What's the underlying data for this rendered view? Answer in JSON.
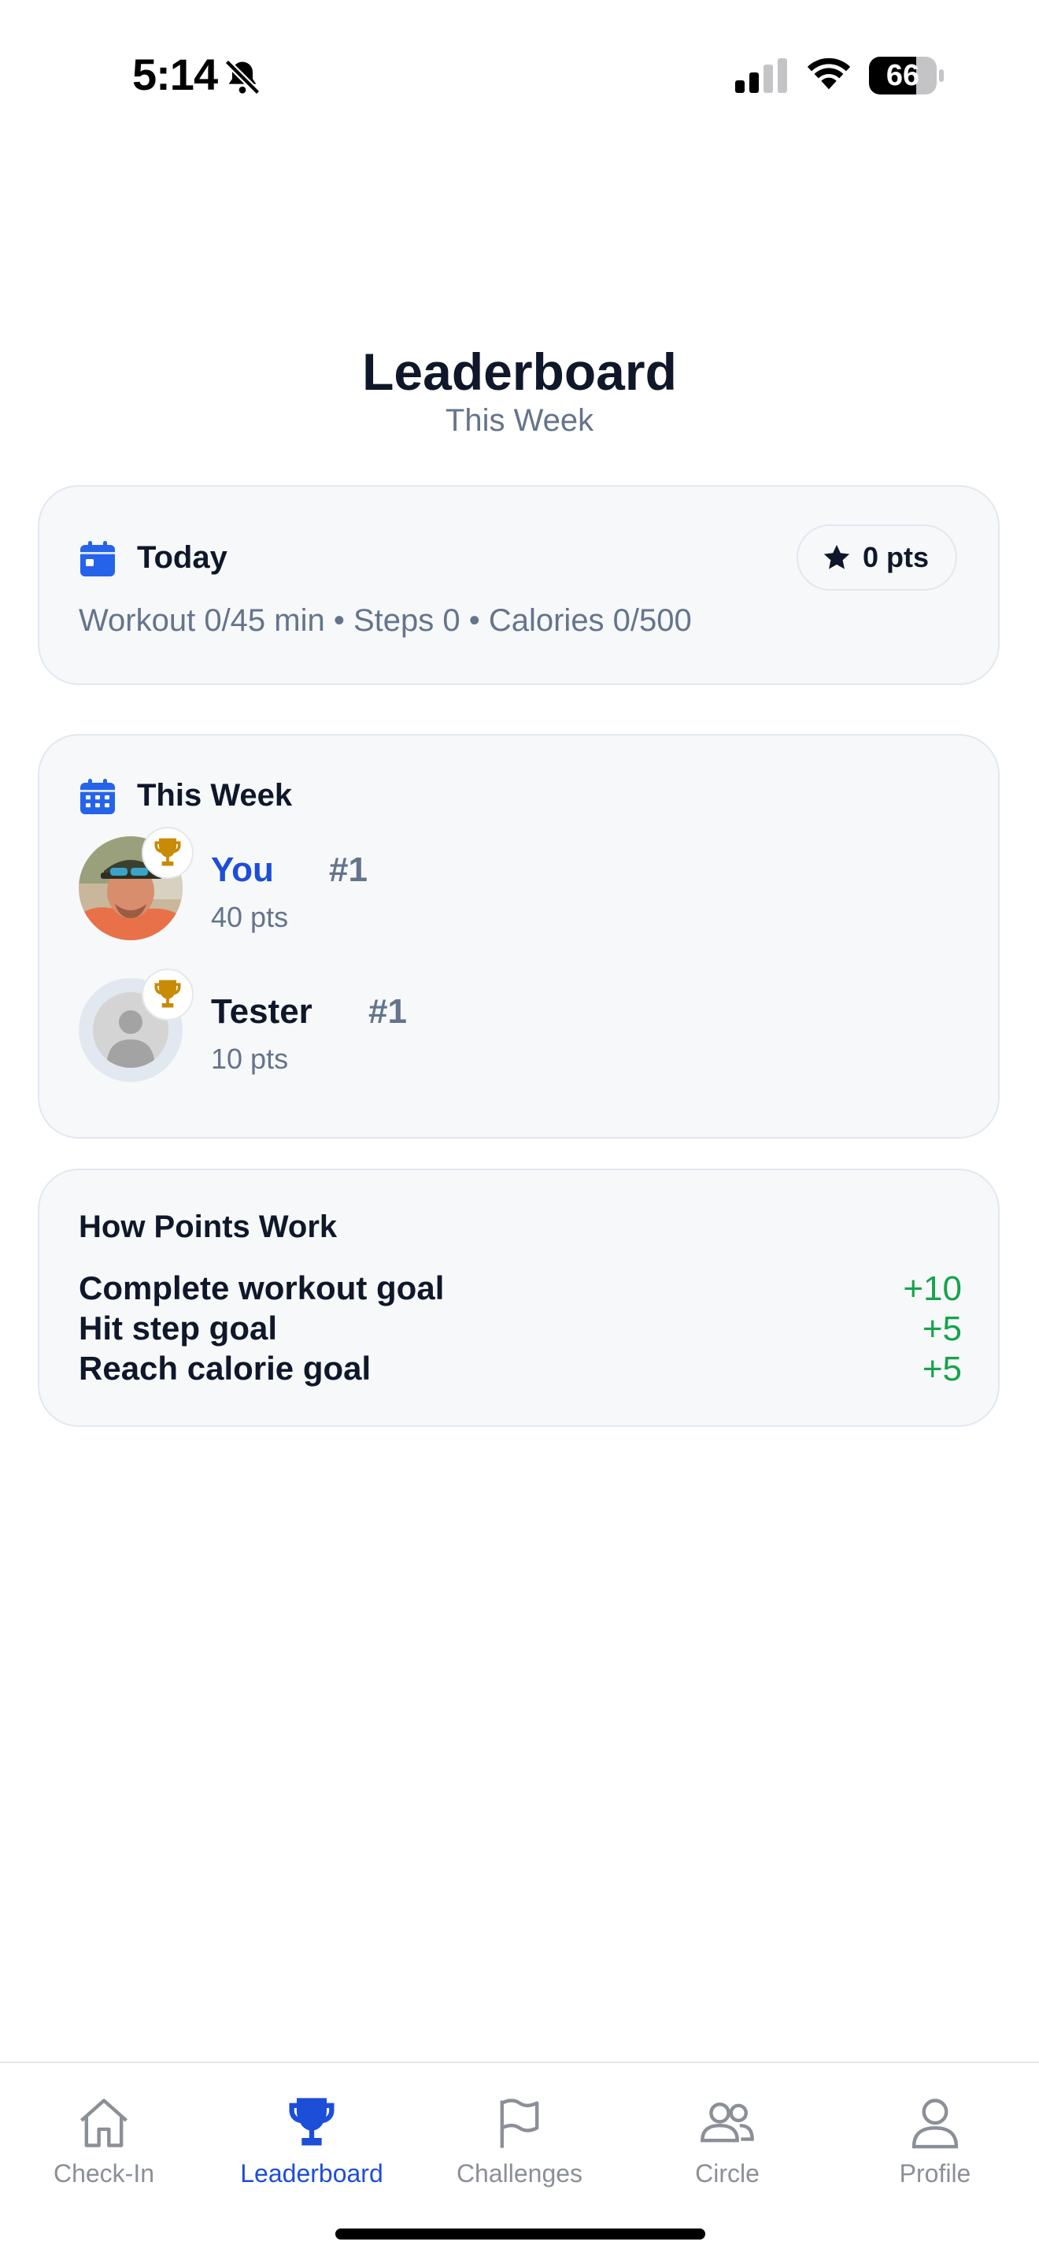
{
  "status_bar": {
    "time": "5:14",
    "battery": "66"
  },
  "header": {
    "title": "Leaderboard",
    "subtitle": "This Week"
  },
  "today": {
    "heading": "Today",
    "points_badge": "0 pts",
    "stats": "Workout 0/45 min • Steps 0 • Calories 0/500"
  },
  "week": {
    "heading": "This Week",
    "entries": [
      {
        "name": "You",
        "rank": "#1",
        "points": "40 pts",
        "name_color": "#1d4ed8"
      },
      {
        "name": "Tester",
        "rank": "#1",
        "points": "10 pts",
        "name_color": "#0f172a"
      }
    ]
  },
  "how_points": {
    "heading": "How Points Work",
    "rules": [
      {
        "label": "Complete workout goal",
        "value": "+10"
      },
      {
        "label": "Hit step goal",
        "value": "+5"
      },
      {
        "label": "Reach calorie goal",
        "value": "+5"
      }
    ]
  },
  "tabs": [
    {
      "label": "Check-In",
      "icon": "home-icon",
      "active": false
    },
    {
      "label": "Leaderboard",
      "icon": "trophy-icon",
      "active": true
    },
    {
      "label": "Challenges",
      "icon": "flag-icon",
      "active": false
    },
    {
      "label": "Circle",
      "icon": "people-icon",
      "active": false
    },
    {
      "label": "Profile",
      "icon": "person-icon",
      "active": false
    }
  ],
  "colors": {
    "accent": "#1d4ed8",
    "positive": "#16a34a",
    "trophy": "#c98a06",
    "muted": "#64748b"
  }
}
